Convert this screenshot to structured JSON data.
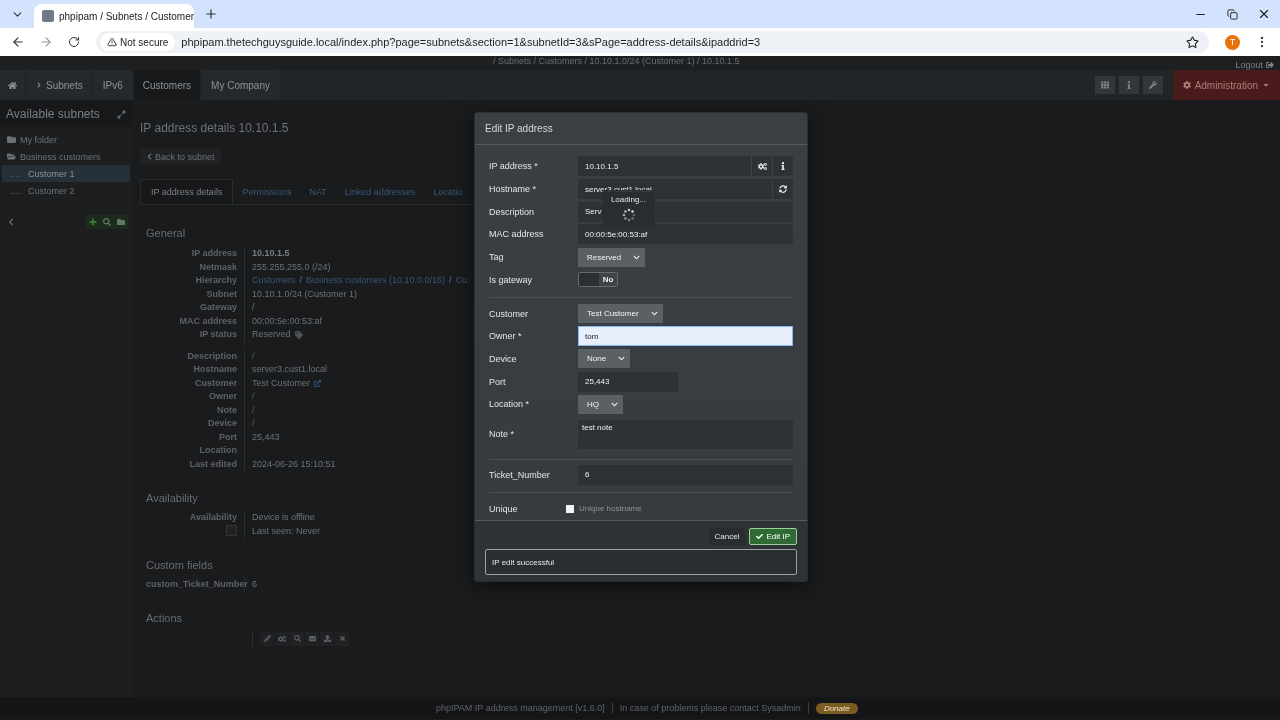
{
  "browser": {
    "tab_title": "phpipam / Subnets / Customer",
    "security": "Not secure",
    "url": "phpipam.thetechguysguide.local/index.php?page=subnets&section=1&subnetId=3&sPage=address-details&ipaddrid=3",
    "profile_initial": "T"
  },
  "header": {
    "breadcrumb": "/ Subnets / Customers / 10.10.1.0/24 (Customer 1) / 10.10.1.5",
    "logout": "Logout"
  },
  "nav": {
    "items": [
      {
        "label": "Subnets",
        "kind": "menu",
        "selected": false
      },
      {
        "label": "IPv6",
        "kind": "link",
        "selected": false
      },
      {
        "label": "Customers",
        "kind": "link",
        "selected": true
      },
      {
        "label": "My Company",
        "kind": "link",
        "selected": false
      }
    ],
    "admin": "Administration"
  },
  "sidebar": {
    "title": "Available subnets",
    "tree": [
      {
        "label": "My folder",
        "expanded": false,
        "selected": false
      },
      {
        "label": "Business customers",
        "expanded": true,
        "selected": false,
        "children": [
          {
            "label": "Customer 1",
            "selected": true
          },
          {
            "label": "Customer 2",
            "selected": false
          }
        ]
      }
    ]
  },
  "page": {
    "title": "IP address details 10.10.1.5",
    "back": "Back to subnet",
    "tabs": [
      {
        "label": "IP address details",
        "selected": true
      },
      {
        "label": "Permissions",
        "selected": false
      },
      {
        "label": "NAT",
        "selected": false
      },
      {
        "label": "Linked addresses",
        "selected": false
      },
      {
        "label": "Locatio",
        "selected": false
      }
    ],
    "general": {
      "heading": "General",
      "groups": [
        [
          {
            "label": "IP address",
            "value": "10.10.1.5",
            "kind": "bold"
          },
          {
            "label": "Netmask",
            "value": "255.255.255.0 (/24)",
            "kind": "text"
          },
          {
            "label": "Hierarchy",
            "kind": "path",
            "separator": "/",
            "links": [
              "Customers",
              "Business customers (10.10.0.0/16)",
              "Cu"
            ]
          },
          {
            "label": "Subnet",
            "value": "10.10.1.0/24 (Customer 1)",
            "kind": "text"
          },
          {
            "label": "Gateway",
            "value": "/",
            "kind": "text"
          },
          {
            "label": "MAC address",
            "value": "00:00:5e:00:53:af",
            "kind": "text"
          },
          {
            "label": "IP status",
            "value": "Reserved",
            "kind": "tag"
          }
        ],
        [
          {
            "label": "Description",
            "value": "/",
            "kind": "muted"
          },
          {
            "label": "Hostname",
            "value": "server3.cust1.local",
            "kind": "text"
          },
          {
            "label": "Customer",
            "value": "Test Customer",
            "kind": "external"
          },
          {
            "label": "Owner",
            "value": "/",
            "kind": "muted"
          },
          {
            "label": "Note",
            "value": "/",
            "kind": "muted"
          },
          {
            "label": "Device",
            "value": "/",
            "kind": "muted"
          },
          {
            "label": "Port",
            "value": "25,443",
            "kind": "text"
          },
          {
            "label": "Location",
            "kind": "empty"
          },
          {
            "label": "Last edited",
            "value": "2024-06-26 15:10:51",
            "kind": "text"
          }
        ]
      ]
    },
    "availability": {
      "heading": "Availability",
      "label": "Availability",
      "lines": [
        "Device is offline",
        "Last seen: Never"
      ]
    },
    "custom_fields": {
      "heading": "Custom fields",
      "rows": [
        {
          "label": "custom_Ticket_Number",
          "value": "6"
        }
      ]
    },
    "actions": {
      "heading": "Actions"
    }
  },
  "modal": {
    "title": "Edit IP address",
    "groups": [
      [
        {
          "kind": "ip",
          "label": "IP address *",
          "value": "10.10.1.5",
          "focused": false
        },
        {
          "kind": "hostname",
          "label": "Hostname *",
          "value": "server3.cust1.local",
          "focused": false
        },
        {
          "kind": "text",
          "label": "Description",
          "value": "Serv",
          "focused": false
        },
        {
          "kind": "text",
          "label": "MAC address",
          "value": "00:00:5e:00:53:af",
          "focused": false
        },
        {
          "kind": "select",
          "label": "Tag",
          "value": "Reserved",
          "focused": false
        },
        {
          "kind": "toggle",
          "label": "Is gateway",
          "value": "No",
          "on": false
        }
      ],
      [
        {
          "kind": "select",
          "label": "Customer",
          "value": "Test Customer",
          "focused": false
        },
        {
          "kind": "text",
          "label": "Owner *",
          "value": "tom",
          "focused": true
        },
        {
          "kind": "select",
          "label": "Device",
          "value": "None",
          "focused": false
        },
        {
          "kind": "short",
          "label": "Port",
          "value": "25,443",
          "focused": false
        },
        {
          "kind": "select",
          "label": "Location *",
          "value": "HQ",
          "focused": false
        },
        {
          "kind": "textarea",
          "label": "Note *",
          "value": "test note",
          "focused": false
        }
      ],
      [
        {
          "kind": "text",
          "label": "Ticket_Number",
          "value": "6",
          "focused": false
        }
      ],
      [
        {
          "kind": "checkbox",
          "label": "Unique",
          "text": "Unique hostname",
          "checked": false
        }
      ]
    ],
    "loading": "Loading...",
    "cancel": "Cancel",
    "submit": "Edit IP",
    "message": "IP edit successful"
  },
  "footer": {
    "app": "phpIPAM IP address management [v1.6.0]",
    "contact": "In case of problems please contact Sysadmin",
    "donate": "Donate"
  }
}
